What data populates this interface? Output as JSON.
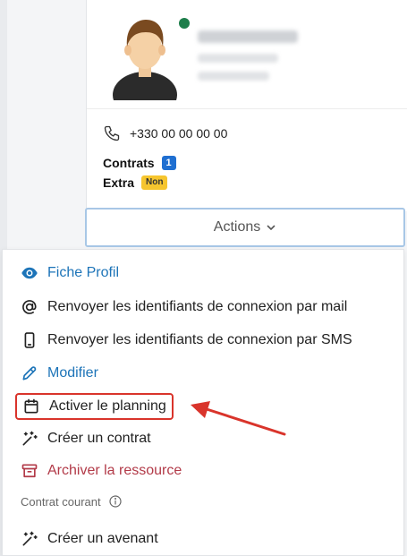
{
  "profile": {
    "phone": "+330 00 00 00 00",
    "contrats_label": "Contrats",
    "contrats_count": "1",
    "extra_label": "Extra",
    "extra_value": "Non"
  },
  "actions": {
    "label": "Actions"
  },
  "menu": {
    "items": [
      {
        "label": "Fiche Profil",
        "icon": "eye-icon"
      },
      {
        "label": "Renvoyer les identifiants de connexion par mail",
        "icon": "at-icon"
      },
      {
        "label": "Renvoyer les identifiants de connexion par SMS",
        "icon": "mobile-icon"
      },
      {
        "label": "Modifier",
        "icon": "pencil-icon"
      },
      {
        "label": "Activer le planning",
        "icon": "calendar-icon"
      },
      {
        "label": "Créer un contrat",
        "icon": "magic-wand-icon"
      },
      {
        "label": "Archiver la ressource",
        "icon": "archive-icon"
      }
    ],
    "section_label": "Contrat courant",
    "section_items": [
      {
        "label": "Créer un avenant",
        "icon": "magic-wand-icon"
      }
    ]
  },
  "colors": {
    "link_blue": "#1d74b8",
    "danger_red": "#b23a48",
    "highlight_red": "#d9342b",
    "status_green": "#1e7e4b",
    "badge_blue": "#1f6fd1",
    "badge_yellow": "#f6c52e"
  }
}
